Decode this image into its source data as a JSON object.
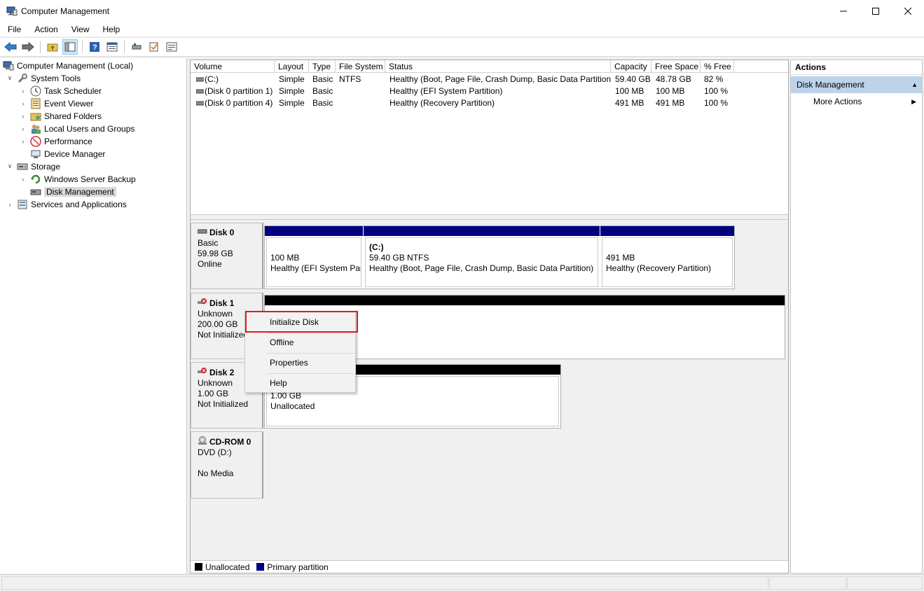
{
  "window": {
    "title": "Computer Management"
  },
  "menu": [
    "File",
    "Action",
    "View",
    "Help"
  ],
  "toolbar": {
    "icons": [
      "back-icon",
      "forward-icon",
      "up-folder-icon",
      "show-hide-tree-icon",
      "help-icon",
      "properties-icon",
      "connect-icon",
      "check-icon",
      "list-icon"
    ]
  },
  "tree": [
    {
      "label": "Computer Management (Local)",
      "name": "tree-computer-management",
      "icon": "computer-icon",
      "level": 0,
      "chev": ""
    },
    {
      "label": "System Tools",
      "name": "tree-system-tools",
      "icon": "tools-icon",
      "level": 1,
      "chev": "v"
    },
    {
      "label": "Task Scheduler",
      "name": "tree-task-scheduler",
      "icon": "clock-icon",
      "level": 2,
      "chev": ">"
    },
    {
      "label": "Event Viewer",
      "name": "tree-event-viewer",
      "icon": "event-viewer-icon",
      "level": 2,
      "chev": ">"
    },
    {
      "label": "Shared Folders",
      "name": "tree-shared-folders",
      "icon": "shared-folder-icon",
      "level": 2,
      "chev": ">"
    },
    {
      "label": "Local Users and Groups",
      "name": "tree-local-users",
      "icon": "users-icon",
      "level": 2,
      "chev": ">"
    },
    {
      "label": "Performance",
      "name": "tree-performance",
      "icon": "performance-icon",
      "level": 2,
      "chev": ">"
    },
    {
      "label": "Device Manager",
      "name": "tree-device-manager",
      "icon": "device-manager-icon",
      "level": 2,
      "chev": ""
    },
    {
      "label": "Storage",
      "name": "tree-storage",
      "icon": "storage-icon",
      "level": 1,
      "chev": "v"
    },
    {
      "label": "Windows Server Backup",
      "name": "tree-server-backup",
      "icon": "backup-icon",
      "level": 2,
      "chev": ">"
    },
    {
      "label": "Disk Management",
      "name": "tree-disk-management",
      "icon": "disk-icon",
      "level": 2,
      "chev": "",
      "selected": true
    },
    {
      "label": "Services and Applications",
      "name": "tree-services-apps",
      "icon": "services-icon",
      "level": 1,
      "chev": ">"
    }
  ],
  "volumes": {
    "headers": [
      "Volume",
      "Layout",
      "Type",
      "File System",
      "Status",
      "Capacity",
      "Free Space",
      "% Free"
    ],
    "rows": [
      [
        "(C:)",
        "Simple",
        "Basic",
        "NTFS",
        "Healthy (Boot, Page File, Crash Dump, Basic Data Partition)",
        "59.40 GB",
        "48.78 GB",
        "82 %"
      ],
      [
        "(Disk 0 partition 1)",
        "Simple",
        "Basic",
        "",
        "Healthy (EFI System Partition)",
        "100 MB",
        "100 MB",
        "100 %"
      ],
      [
        "(Disk 0 partition 4)",
        "Simple",
        "Basic",
        "",
        "Healthy (Recovery Partition)",
        "491 MB",
        "491 MB",
        "100 %"
      ]
    ]
  },
  "disks": {
    "disk0": {
      "name": "Disk 0",
      "type": "Basic",
      "size": "59.98 GB",
      "status": "Online",
      "partitions": [
        {
          "title": "",
          "line1": "100 MB",
          "line2": "Healthy (EFI System Par"
        },
        {
          "title": "(C:)",
          "line1": "59.40 GB NTFS",
          "line2": "Healthy (Boot, Page File, Crash Dump, Basic Data Partition)"
        },
        {
          "title": "",
          "line1": "491 MB",
          "line2": "Healthy (Recovery Partition)"
        }
      ]
    },
    "disk1": {
      "name": "Disk 1",
      "type": "Unknown",
      "size": "200.00 GB",
      "status": "Not Initialized"
    },
    "disk2": {
      "name": "Disk 2",
      "type": "Unknown",
      "size": "1.00 GB",
      "status": "Not Initialized",
      "partition": {
        "line1": "1.00 GB",
        "line2": "Unallocated"
      }
    },
    "cdrom0": {
      "name": "CD-ROM 0",
      "type": "DVD (D:)",
      "status": "No Media"
    }
  },
  "legend": [
    {
      "label": "Unallocated",
      "color": "#000000"
    },
    {
      "label": "Primary partition",
      "color": "#000080"
    }
  ],
  "context_menu": [
    "Initialize Disk",
    "Offline",
    "Properties",
    "Help"
  ],
  "actions": {
    "header": "Actions",
    "group": "Disk Management",
    "items": [
      "More Actions"
    ]
  },
  "colors": {
    "primary_partition": "#000080",
    "unallocated": "#000000",
    "highlight": "#e0191f",
    "action_group": "#bcd3ea"
  }
}
